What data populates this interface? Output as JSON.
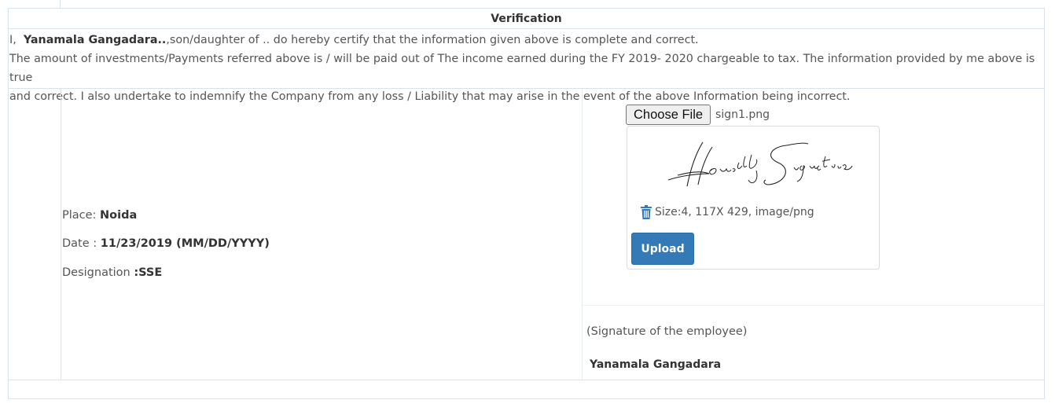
{
  "verification": {
    "title": "Verification",
    "decl_prefix": "I,",
    "employee_name": "Yanamala Gangadara..",
    "decl_line1_rest": ",son/daughter of    .. do hereby certify that the information given above is complete and correct.",
    "decl_line2": "The amount of investments/Payments referred above is / will be paid out of The income earned during the FY 2019- 2020 chargeable to tax. The information provided by me above is true",
    "decl_line3": "and correct. I also undertake to indemnify the Company from any loss / Liability that may arise in the event of the above Information being incorrect."
  },
  "details": {
    "place_label": "Place:",
    "place_value": "Noida",
    "date_label": "Date :",
    "date_value": "11/23/2019 (MM/DD/YYYY)",
    "designation_label": "Designation",
    "designation_value": ":SSE"
  },
  "uploader": {
    "choose_label": "Choose File",
    "file_name": "sign1.png",
    "file_info": "Size:4, 117X 429, image/png",
    "upload_label": "Upload",
    "delete_icon": "trash-icon",
    "signature_text": "Houstely Signature"
  },
  "signature": {
    "caption": "(Signature of the employee)",
    "name": "Yanamala Gangadara"
  },
  "colors": {
    "border": "#d6e2ec",
    "upload_button": "#337ab7",
    "trash_icon": "#337ab7"
  }
}
